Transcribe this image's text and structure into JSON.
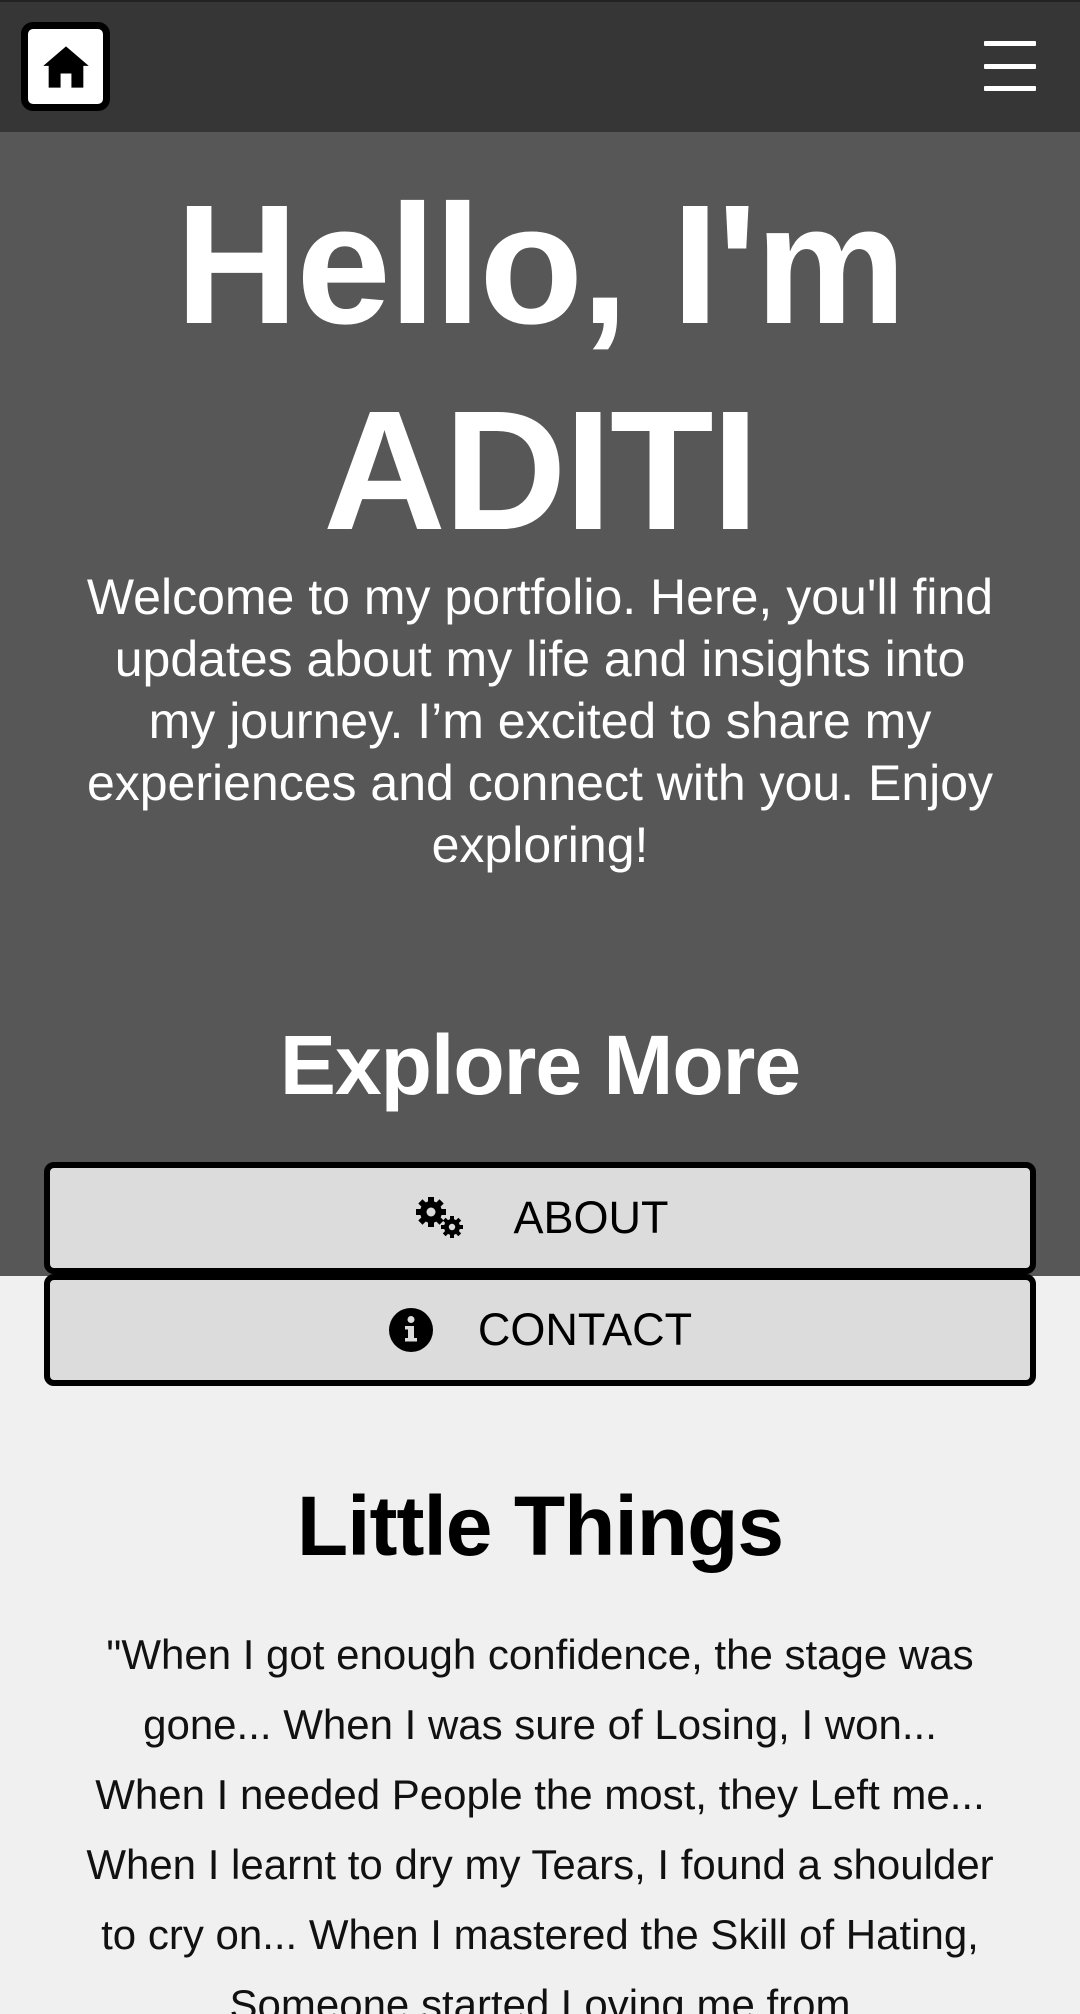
{
  "header": {
    "home_icon": "home-icon",
    "menu_icon": "hamburger-menu-icon"
  },
  "hero": {
    "title_line1": "Hello, I'm",
    "title_line2": "ADITI",
    "intro": "Welcome to my portfolio. Here, you'll find updates about my life and insights into my journey. I’m excited to share my experiences and connect with you. Enjoy exploring!",
    "explore_title": "Explore More"
  },
  "nav": {
    "about_label": "ABOUT",
    "about_icon": "gears-icon",
    "contact_label": "CONTACT",
    "contact_icon": "info-circle-icon"
  },
  "little_things": {
    "title": "Little Things",
    "text": "\"When I got enough confidence, the stage was gone... When I was sure of Losing, I won... When I needed People the most, they Left me... When I learnt to dry my Tears, I found a shoulder to cry on... When I mastered the Skill of Hating, Someone started Loving me from"
  },
  "colors": {
    "topbar": "#363636",
    "hero_bg": "#575757",
    "page_bg": "#f0f0f0",
    "button_bg": "#dcdcdc"
  }
}
